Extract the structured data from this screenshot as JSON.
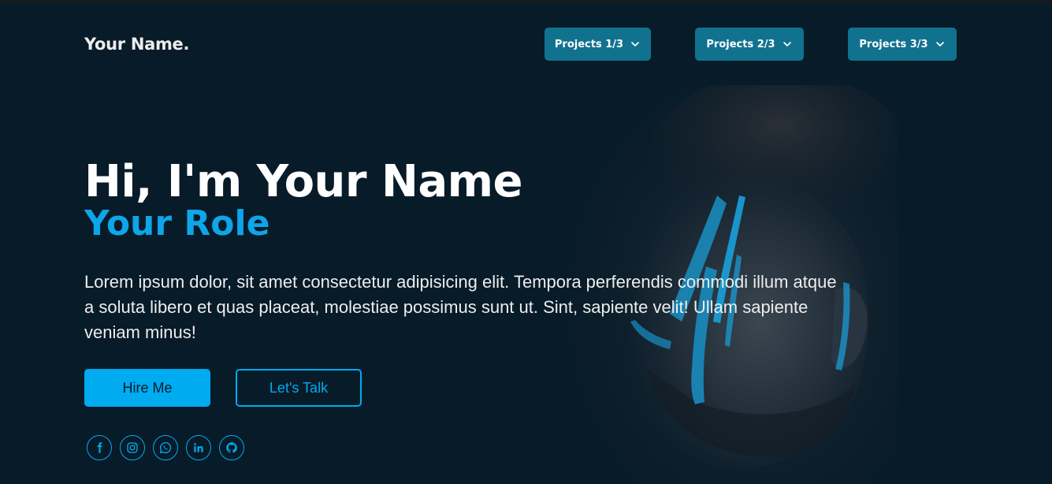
{
  "header": {
    "logo": "Your Name.",
    "nav": [
      {
        "label": "Projects 1/3",
        "icon": "chevron-down-icon"
      },
      {
        "label": "Projects 2/3",
        "icon": "chevron-down-icon"
      },
      {
        "label": "Projects 3/3",
        "icon": "chevron-down-icon"
      }
    ]
  },
  "hero": {
    "title": "Hi, I'm Your Name",
    "role": "Your Role",
    "description": "Lorem ipsum dolor, sit amet consectetur adipisicing elit. Tempora perferendis commodi illum atque a soluta libero et quas placeat, molestiae possimus sunt ut. Sint, sapiente velit! Ullam sapiente veniam minus!",
    "buttons": {
      "hire": "Hire Me",
      "talk": "Let's Talk"
    },
    "social": [
      "facebook-icon",
      "instagram-icon",
      "whatsapp-icon",
      "linkedin-icon",
      "github-icon"
    ]
  },
  "colors": {
    "background": "#081b29",
    "accent": "#00abf0",
    "nav_button": "#11728f",
    "text": "#ededed"
  }
}
